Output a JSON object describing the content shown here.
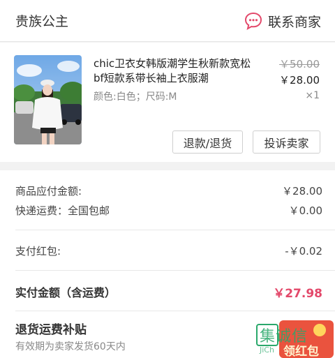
{
  "shop": {
    "name": "贵族公主",
    "contact_label": "联系商家",
    "contact_icon": "chat-bubble-icon",
    "accent_color": "#e3486a"
  },
  "product": {
    "title": "chic卫衣女韩版潮学生秋新款宽松bf短款系带长袖上衣服潮",
    "sku": "颜色:白色；尺码:M",
    "original_price": "￥50.00",
    "price": "￥28.00",
    "quantity": "×1",
    "buttons": {
      "refund": "退款/退货",
      "complain": "投诉卖家"
    }
  },
  "summary": {
    "goods_label": "商品应付金额:",
    "goods_value": "￥28.00",
    "shipping_label": "快递运费：全国包邮",
    "shipping_value": "￥0.00",
    "coupon_label": "支付红包:",
    "coupon_value": "-￥0.02",
    "paid_label": "实付金额（含运费）",
    "paid_value": "￥27.98"
  },
  "subsidy": {
    "title": "退货运费补贴",
    "note": "有效期为卖家发货60天内"
  },
  "watermark": {
    "text": "集诚信",
    "sub": "JiCh",
    "badge": "领红包"
  }
}
